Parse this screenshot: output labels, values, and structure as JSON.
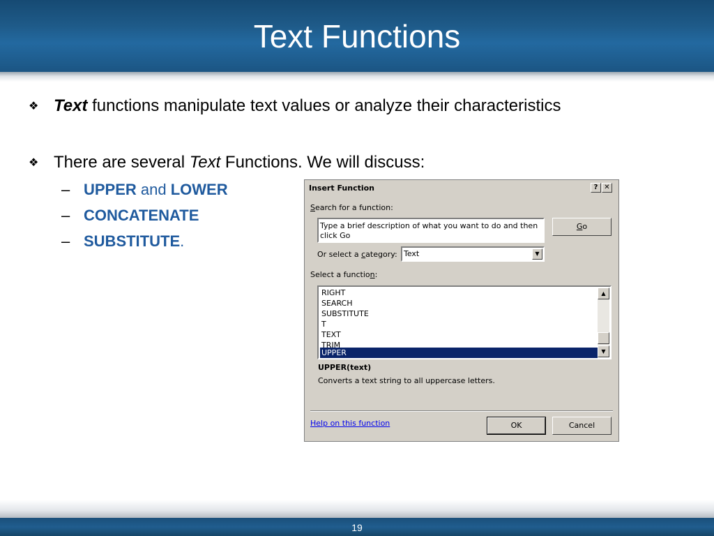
{
  "slide": {
    "title": "Text Functions",
    "page_number": "19",
    "bullet1": {
      "italic": "Text",
      "rest": " functions manipulate text values or analyze their characteristics"
    },
    "bullet2": {
      "before": "There are several ",
      "italic": "Text",
      "after": " Functions.  We will discuss:"
    },
    "sub1": {
      "kw1": "UPPER",
      "mid": " and ",
      "kw2": "LOWER"
    },
    "sub2": {
      "kw": "CONCATENATE"
    },
    "sub3": {
      "kw": "SUBSTITUTE",
      "tail": "."
    },
    "bullet_icon": "diamond-bullet-icon",
    "dash": "–"
  },
  "dialog": {
    "title": "Insert Function",
    "help_btn": "?",
    "close_btn": "✕",
    "search_label_a": "S",
    "search_label_b": "earch for a function:",
    "search_value": "Type a brief description of what you want to do and then click Go",
    "go_btn_a": "G",
    "go_btn_b": "o",
    "category_label_a": "Or select a ",
    "category_label_c": "c",
    "category_label_b": "ategory:",
    "category_value": "Text",
    "select_label_a": "Select a functio",
    "select_label_n": "n",
    "select_label_b": ":",
    "functions": [
      "RIGHT",
      "SEARCH",
      "SUBSTITUTE",
      "T",
      "TEXT",
      "TRIM",
      "UPPER"
    ],
    "selected_function": "UPPER",
    "signature": "UPPER(text)",
    "description": "Converts a text string to all uppercase letters.",
    "help_link": "Help on this function",
    "ok_btn": "OK",
    "cancel_btn": "Cancel"
  },
  "colors": {
    "header": "#1e5a88",
    "keyword": "#1f5a9e",
    "selection": "#0a246a"
  }
}
